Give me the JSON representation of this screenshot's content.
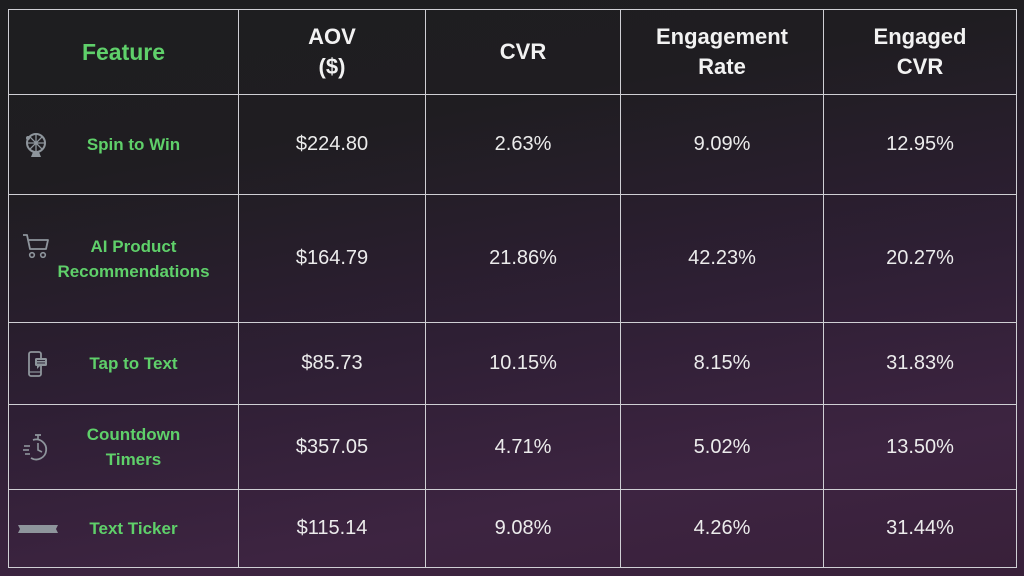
{
  "table": {
    "headers": [
      "Feature",
      "AOV\n($)",
      "CVR",
      "Engagement\nRate",
      "Engaged\nCVR"
    ],
    "header_lines": [
      [
        "Feature"
      ],
      [
        "AOV",
        "($)"
      ],
      [
        "CVR"
      ],
      [
        "Engagement",
        "Rate"
      ],
      [
        "Engaged",
        "CVR"
      ]
    ],
    "rows": [
      {
        "icon": "spin-wheel-icon",
        "feature": "Spin to Win",
        "aov": "$224.80",
        "cvr": "2.63%",
        "engagement_rate": "9.09%",
        "engaged_cvr": "12.95%"
      },
      {
        "icon": "shopping-cart-icon",
        "feature": "AI Product Recommendations",
        "feature_lines": [
          "AI Product",
          "Recommendations"
        ],
        "aov": "$164.79",
        "cvr": "21.86%",
        "engagement_rate": "42.23%",
        "engaged_cvr": "20.27%"
      },
      {
        "icon": "phone-message-icon",
        "feature": "Tap to Text",
        "aov": "$85.73",
        "cvr": "10.15%",
        "engagement_rate": "8.15%",
        "engaged_cvr": "31.83%"
      },
      {
        "icon": "stopwatch-icon",
        "feature": "Countdown Timers",
        "feature_lines": [
          "Countdown",
          "Timers"
        ],
        "aov": "$357.05",
        "cvr": "4.71%",
        "engagement_rate": "5.02%",
        "engaged_cvr": "13.50%"
      },
      {
        "icon": "ribbon-banner-icon",
        "feature": "Text Ticker",
        "aov": "$115.14",
        "cvr": "9.08%",
        "engagement_rate": "4.26%",
        "engaged_cvr": "31.44%"
      }
    ]
  },
  "colors": {
    "feature_text": "#5fd06a",
    "header_text": "#f2f2f2",
    "value_text": "#ececec",
    "grid_lines": "#cfcfd4",
    "icon_gray": "#8e959c"
  }
}
